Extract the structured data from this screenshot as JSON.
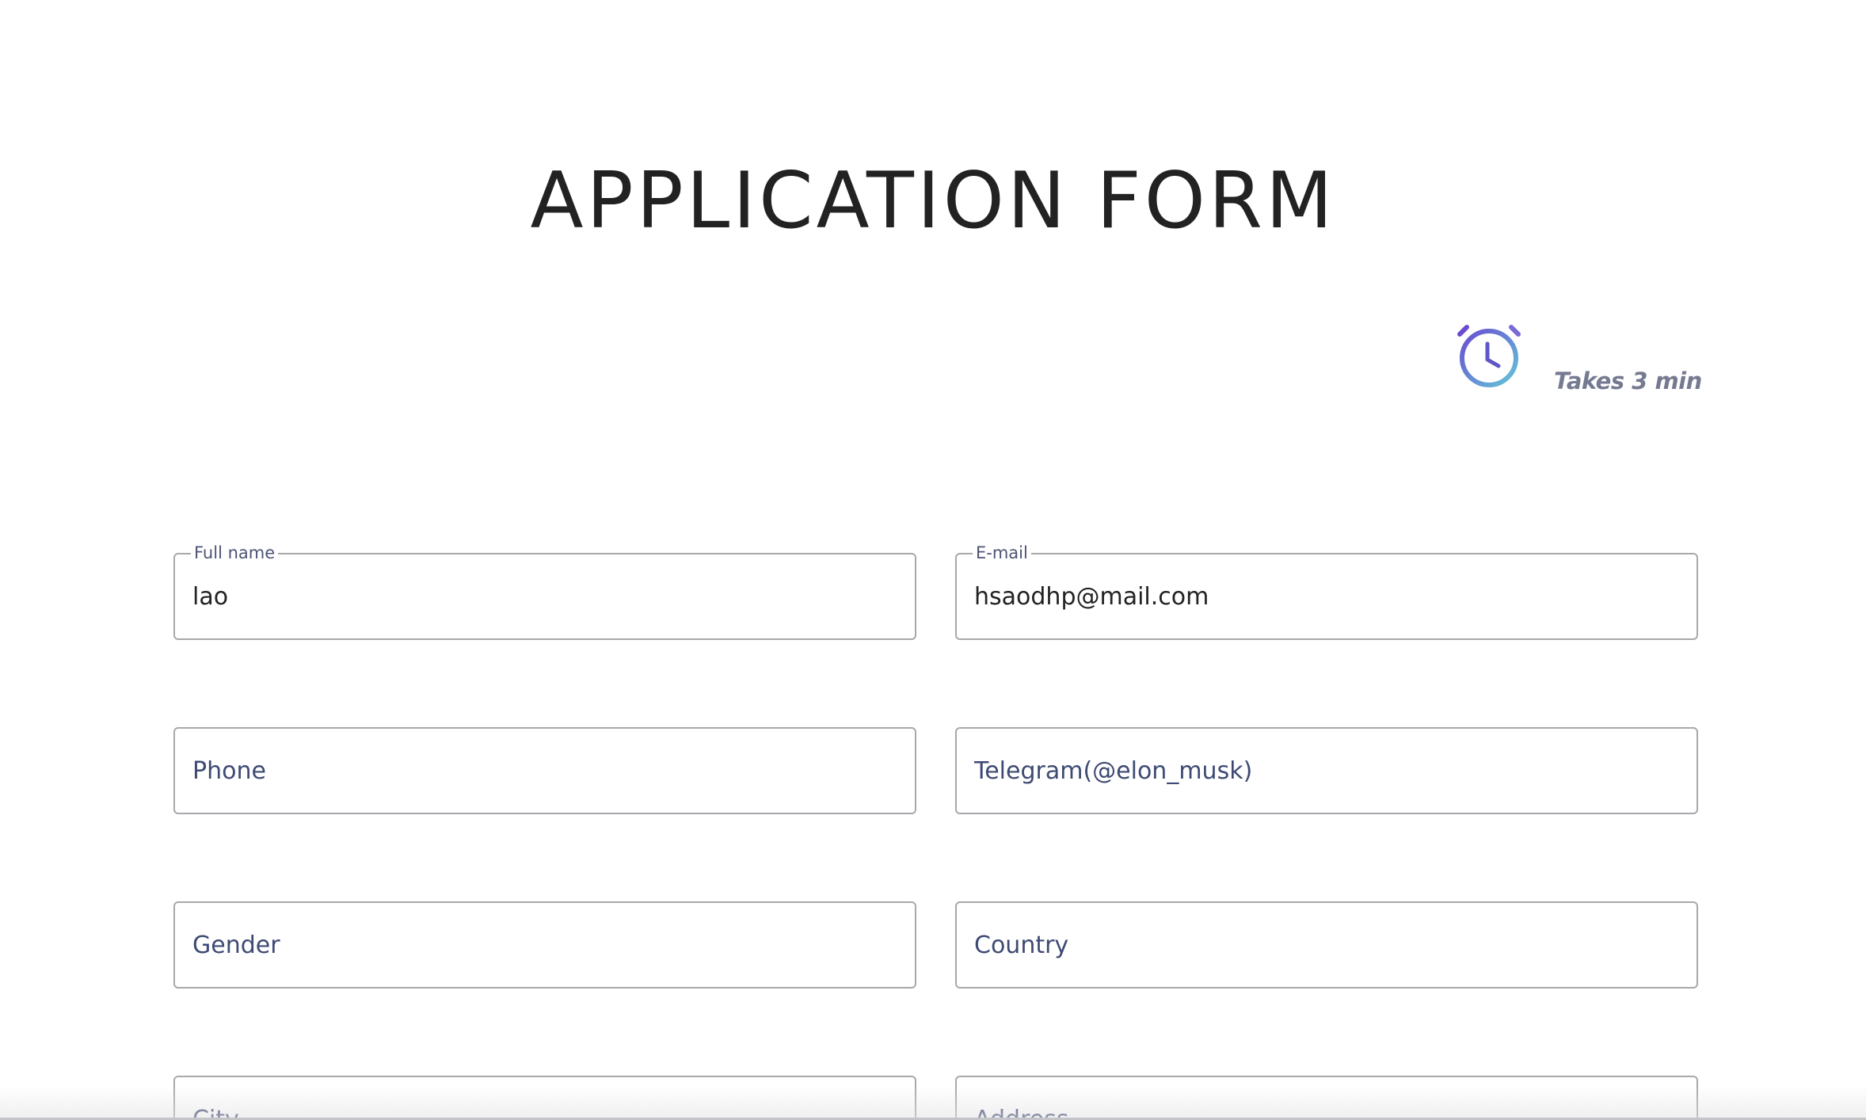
{
  "page": {
    "title": "APPLICATION FORM"
  },
  "time_estimate": {
    "icon": "alarm-clock-icon",
    "text": "Takes 3 min",
    "icon_gradient": [
      "#6a4bd0",
      "#62c6d8"
    ]
  },
  "form": {
    "full_name": {
      "label": "Full name",
      "value": "lao",
      "placeholder": ""
    },
    "email": {
      "label": "E-mail",
      "value": "hsaodhp@mail.com",
      "placeholder": ""
    },
    "phone": {
      "value": "",
      "placeholder": "Phone"
    },
    "telegram": {
      "value": "",
      "placeholder": "Telegram(@elon_musk)"
    },
    "gender": {
      "value": "",
      "placeholder": "Gender"
    },
    "country": {
      "value": "",
      "placeholder": "Country"
    },
    "city": {
      "value": "",
      "placeholder": "City"
    },
    "address": {
      "value": "",
      "placeholder": "Address"
    }
  },
  "colors": {
    "title": "#222222",
    "field_border": "#a8a8ad",
    "label": "#4d5474",
    "placeholder": "#3e4a73",
    "muted_text": "#757a91"
  }
}
